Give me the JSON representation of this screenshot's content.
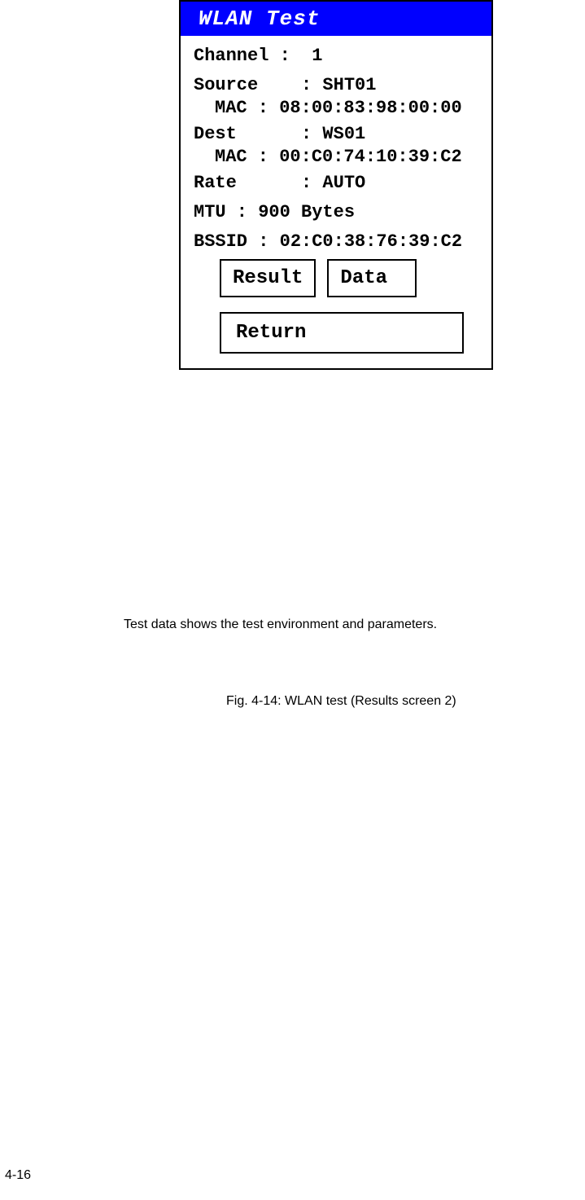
{
  "screen": {
    "title": "WLAN Test",
    "channel_line": "Channel :  1",
    "source_line": "Source    : SHT01",
    "source_mac_line": "MAC : 08:00:83:98:00:00",
    "dest_line": "Dest      : WS01",
    "dest_mac_line": "MAC : 00:C0:74:10:39:C2",
    "rate_line": "Rate      : AUTO",
    "mtu_line": "MTU : 900 Bytes",
    "bssid_line": "BSSID : 02:C0:38:76:39:C2",
    "buttons": {
      "result": "Result",
      "data": "Data",
      "return": "Return"
    }
  },
  "caption1": "Test data shows the test environment and parameters.",
  "caption2": "Fig. 4-14: WLAN test (Results screen 2)",
  "page_number": "4-16"
}
